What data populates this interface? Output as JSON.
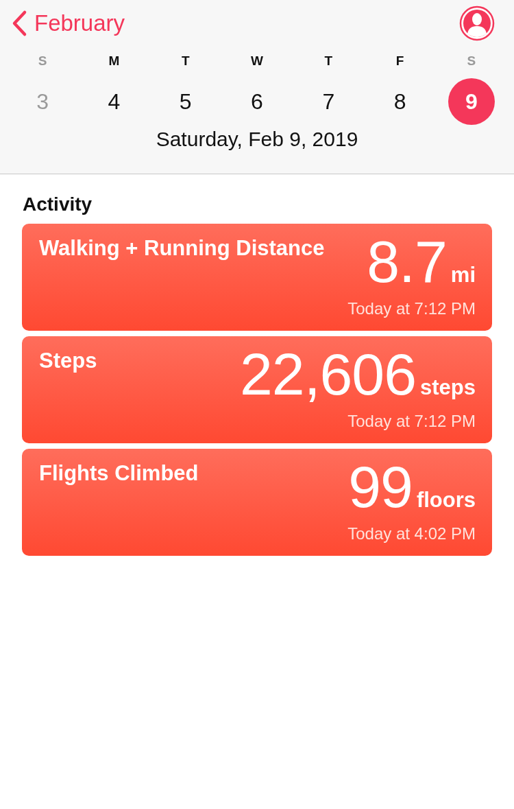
{
  "header": {
    "back_label": "February",
    "days": [
      {
        "letter": "S",
        "date": "3",
        "weekend": true,
        "dimmed": true,
        "selected": false
      },
      {
        "letter": "M",
        "date": "4",
        "weekend": false,
        "dimmed": false,
        "selected": false
      },
      {
        "letter": "T",
        "date": "5",
        "weekend": false,
        "dimmed": false,
        "selected": false
      },
      {
        "letter": "W",
        "date": "6",
        "weekend": false,
        "dimmed": false,
        "selected": false
      },
      {
        "letter": "T",
        "date": "7",
        "weekend": false,
        "dimmed": false,
        "selected": false
      },
      {
        "letter": "F",
        "date": "8",
        "weekend": false,
        "dimmed": false,
        "selected": false
      },
      {
        "letter": "S",
        "date": "9",
        "weekend": true,
        "dimmed": false,
        "selected": true
      }
    ],
    "date_label": "Saturday, Feb 9, 2019"
  },
  "section_title": "Activity",
  "cards": [
    {
      "title": "Walking + Running Distance",
      "value": "8.7",
      "unit": "mi",
      "time": "Today at 7:12 PM"
    },
    {
      "title": "Steps",
      "value": "22,606",
      "unit": "steps",
      "time": "Today at 7:12 PM"
    },
    {
      "title": "Flights Climbed",
      "value": "99",
      "unit": "floors",
      "time": "Today at 4:02 PM"
    }
  ]
}
